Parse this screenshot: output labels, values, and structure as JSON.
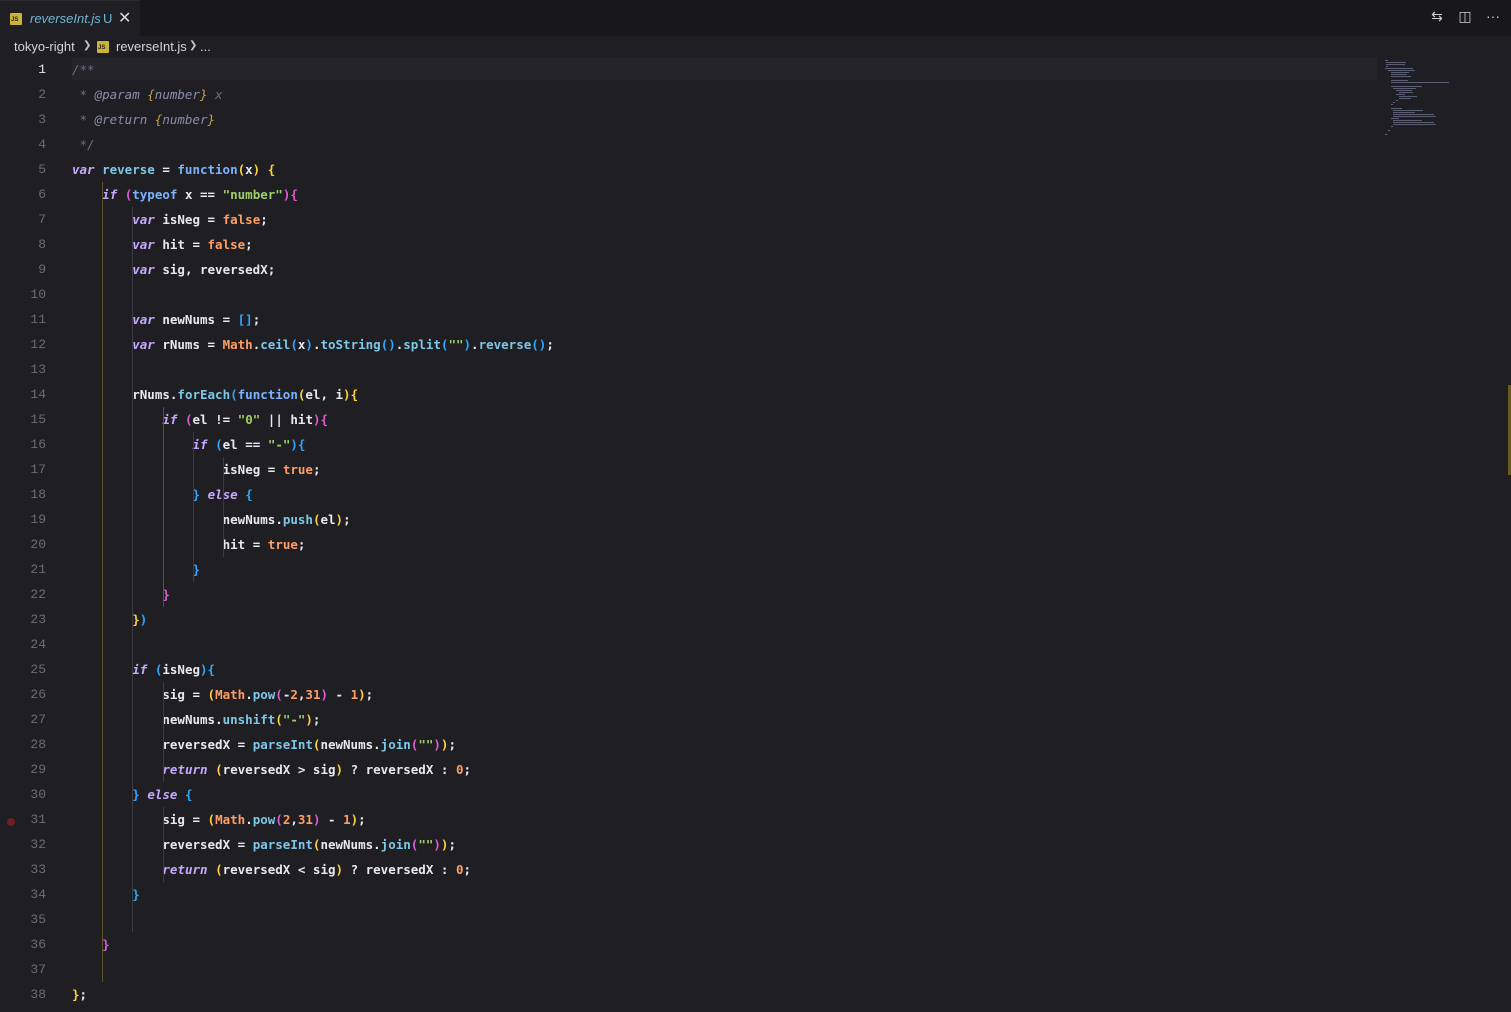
{
  "tab": {
    "filename": "reverseInt.js",
    "status": "U",
    "close": "✕",
    "badge": "JS"
  },
  "breadcrumb": {
    "folder": "tokyo-right",
    "file": "reverseInt.js",
    "more": "...",
    "sep": "❯",
    "badge": "JS"
  },
  "toolbar": {
    "compare": "⇆",
    "split": "◫",
    "more": "···"
  },
  "editor": {
    "active_line": 1,
    "breakpoint_line": 31,
    "line_numbers": [
      "1",
      "2",
      "3",
      "4",
      "5",
      "6",
      "7",
      "8",
      "9",
      "10",
      "11",
      "12",
      "13",
      "14",
      "15",
      "16",
      "17",
      "18",
      "19",
      "20",
      "21",
      "22",
      "23",
      "24",
      "25",
      "26",
      "27",
      "28",
      "29",
      "30",
      "31",
      "32",
      "33",
      "34",
      "35",
      "36",
      "37",
      "38"
    ],
    "lines": [
      "/**",
      " * @param {number} x",
      " * @return {number}",
      " */",
      "var reverse = function(x) {",
      "    if (typeof x == \"number\"){",
      "        var isNeg = false;",
      "        var hit = false;",
      "        var sig, reversedX;",
      "",
      "        var newNums = [];",
      "        var rNums = Math.ceil(x).toString().split(\"\").reverse();",
      "",
      "        rNums.forEach(function(el, i){",
      "            if (el != \"0\" || hit){",
      "                if (el == \"-\"){",
      "                    isNeg = true;",
      "                } else {",
      "                    newNums.push(el);",
      "                    hit = true;",
      "                }",
      "            }",
      "        })",
      "",
      "        if (isNeg){",
      "            sig = (Math.pow(-2,31) - 1);",
      "            newNums.unshift(\"-\");",
      "            reversedX = parseInt(newNums.join(\"\"));",
      "            return (reversedX > sig) ? reversedX : 0;",
      "        } else {",
      "            sig = (Math.pow(2,31) - 1);",
      "            reversedX = parseInt(newNums.join(\"\"));",
      "            return (reversedX < sig) ? reversedX : 0;",
      "        }",
      "",
      "    }",
      "",
      "};"
    ]
  }
}
